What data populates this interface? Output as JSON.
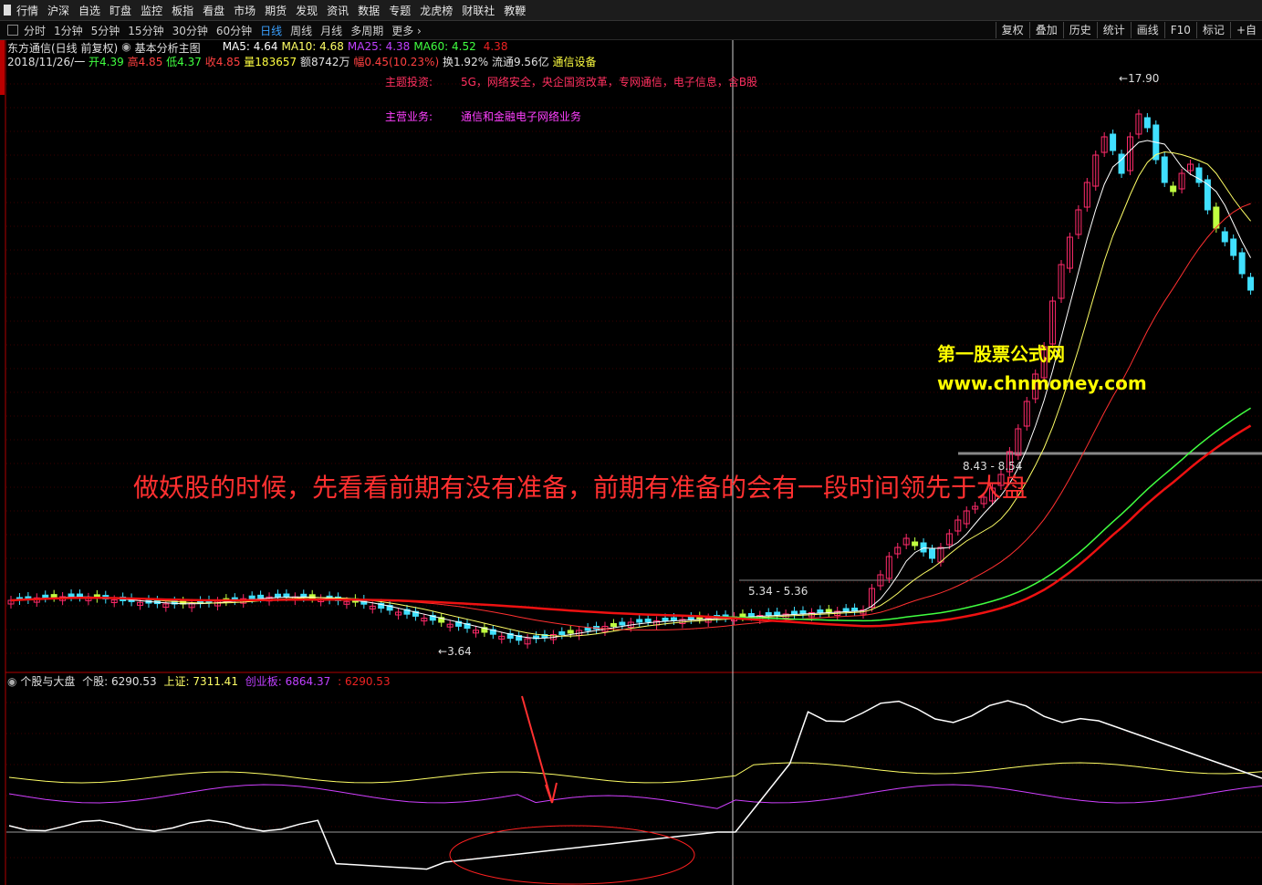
{
  "topmenu": [
    "行情",
    "沪深",
    "自选",
    "盯盘",
    "监控",
    "板指",
    "看盘",
    "市场",
    "期货",
    "发现",
    "资讯",
    "数据",
    "专题",
    "龙虎榜",
    "财联社",
    "教鞭"
  ],
  "periods": [
    "分时",
    "1分钟",
    "5分钟",
    "15分钟",
    "30分钟",
    "60分钟",
    "日线",
    "周线",
    "月线",
    "多周期",
    "更多"
  ],
  "active_period": "日线",
  "right_tools": [
    "复权",
    "叠加",
    "历史",
    "统计",
    "画线",
    "F10",
    "标记",
    "+自"
  ],
  "title": {
    "stock": "东方通信(日线 前复权)",
    "indicator": "基本分析主图",
    "ma5": "MA5: 4.64",
    "ma10": "MA10: 4.68",
    "ma25": "MA25: 4.38",
    "ma60": "MA60: 4.52",
    "extra": "4.38"
  },
  "quote": {
    "date": "2018/11/26/一",
    "open": "开4.39",
    "high": "高4.85",
    "low": "低4.37",
    "close": "收4.85",
    "vol": "量183657",
    "amount": "额8742万",
    "change": "幅0.45(10.23%)",
    "turnover": "换1.92%",
    "float": "流通9.56亿",
    "industry": "通信设备"
  },
  "theme_label": "主题投资:",
  "theme_value": "5G，网络安全，央企国资改革，专网通信，电子信息，含B股",
  "business_label": "主营业务:",
  "business_value": "通信和金融电子网络业务",
  "watermark_name": "第一股票公式网",
  "watermark_url": "www.chnmoney.com",
  "annotation": "做妖股的时候，先看看前期有没有准备，前期有准备的会有一段时间领先于大盘",
  "price_labels": {
    "high": "17.90",
    "low": "3.64",
    "band1": "5.34 - 5.36",
    "band2": "8.43 - 8.54"
  },
  "sub": {
    "name": "个股与大盘",
    "stock": "个股: 6290.53",
    "sh": "上证: 7311.41",
    "cyb": "创业板: 6864.37",
    "extra": ": 6290.53"
  },
  "colors": {
    "up": "#ff2a6a",
    "down": "#40e0ff",
    "ma5": "#ffffff",
    "ma10": "#ffff66",
    "ma25": "#c040ff",
    "ma60": "#40ff40",
    "ma_red": "#ee1111"
  }
}
